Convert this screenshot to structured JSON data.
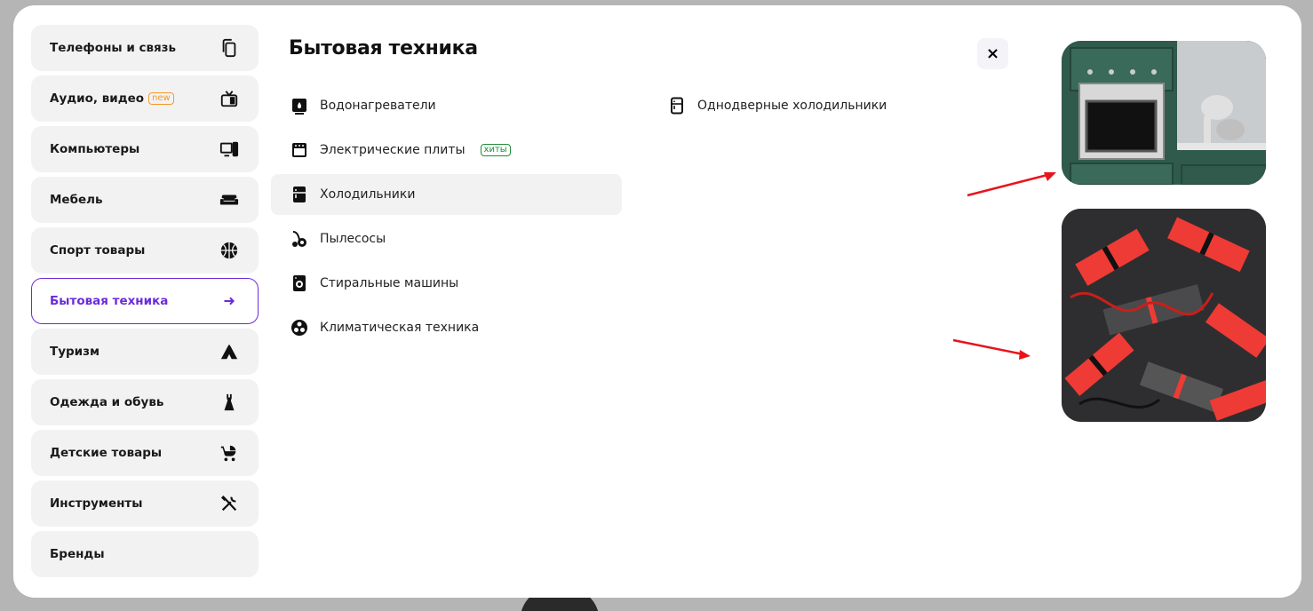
{
  "sidebar": {
    "items": [
      {
        "label": "Телефоны и связь",
        "icon": "phones-icon"
      },
      {
        "label": "Аудио, видео",
        "badge": "new",
        "icon": "tv-icon"
      },
      {
        "label": "Компьютеры",
        "icon": "computer-icon"
      },
      {
        "label": "Мебель",
        "icon": "sofa-icon"
      },
      {
        "label": "Спорт товары",
        "icon": "basketball-icon"
      },
      {
        "label": "Бытовая техника",
        "icon": "arrow-right-icon",
        "active": true
      },
      {
        "label": "Туризм",
        "icon": "tent-icon"
      },
      {
        "label": "Одежда и обувь",
        "icon": "dress-icon"
      },
      {
        "label": "Детские товары",
        "icon": "stroller-icon"
      },
      {
        "label": "Инструменты",
        "icon": "tools-icon"
      },
      {
        "label": "Бренды",
        "icon": ""
      }
    ]
  },
  "main": {
    "title": "Бытовая техника",
    "close_label": "×",
    "column1": [
      {
        "label": "Водонагреватели",
        "icon": "water-heater-icon"
      },
      {
        "label": "Электрические плиты",
        "badge": "хиты",
        "icon": "stove-icon"
      },
      {
        "label": "Холодильники",
        "icon": "fridge-icon",
        "hover": true
      },
      {
        "label": "Пылесосы",
        "icon": "vacuum-icon"
      },
      {
        "label": "Стиральные машины",
        "icon": "washing-machine-icon"
      },
      {
        "label": "Климатическая техника",
        "icon": "fan-icon"
      }
    ],
    "column2": [
      {
        "label": "Однодверные холодильники",
        "icon": "single-door-fridge-icon"
      }
    ]
  },
  "colors": {
    "accent": "#6c2bd9",
    "new_badge": "#f39a2d",
    "hit_badge": "#1f8a3a",
    "arrow": "#e8141c"
  }
}
